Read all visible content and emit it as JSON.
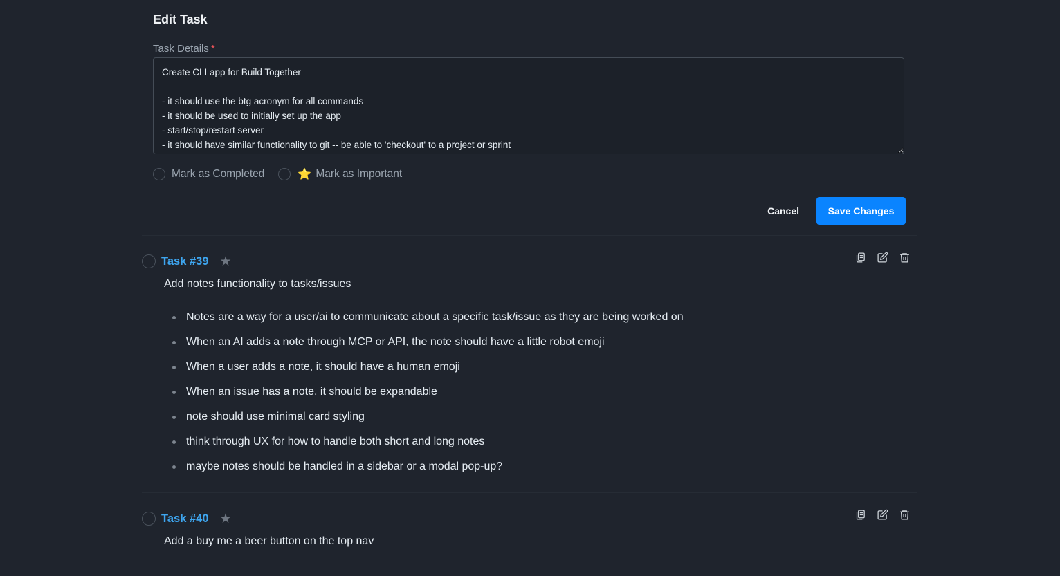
{
  "edit_form": {
    "title": "Edit Task",
    "field_label": "Task Details",
    "required_mark": "*",
    "task_details_value": "Create CLI app for Build Together\n\n- it should use the btg acronym for all commands\n- it should be used to initially set up the app\n- start/stop/restart server\n- it should have similar functionality to git -- be able to 'checkout' to a project or sprint",
    "mark_completed_label": "Mark as Completed",
    "mark_completed_checked": false,
    "mark_important_icon": "star-emoji",
    "mark_important_emoji": "⭐",
    "mark_important_label": "Mark as Important",
    "mark_important_checked": false,
    "cancel_label": "Cancel",
    "save_label": "Save Changes"
  },
  "tasks": [
    {
      "id_label": "Task #39",
      "completed": false,
      "important": false,
      "title": "Add notes functionality to tasks/issues",
      "bullets": [
        "Notes are a way for a user/ai to communicate about a specific task/issue as they are being worked on",
        "When an AI adds a note through MCP or API, the note should have a little robot emoji",
        "When a user adds a note, it should have a human emoji",
        "When an issue has a note, it should be expandable",
        "note should use minimal card styling",
        "think through UX for how to handle both short and long notes",
        "maybe notes should be handled in a sidebar or a modal pop-up?"
      ],
      "actions": [
        "copy-icon",
        "edit-icon",
        "trash-icon"
      ]
    },
    {
      "id_label": "Task #40",
      "completed": false,
      "important": false,
      "title": "Add a buy me a beer button on the top nav",
      "bullets": [],
      "actions": [
        "copy-icon",
        "edit-icon",
        "trash-icon"
      ]
    }
  ],
  "colors": {
    "background": "#1f242d",
    "accent_link": "#3ea6f0",
    "primary_button": "#0a84ff",
    "required": "#f0555a",
    "important_star": "#f5b400"
  }
}
